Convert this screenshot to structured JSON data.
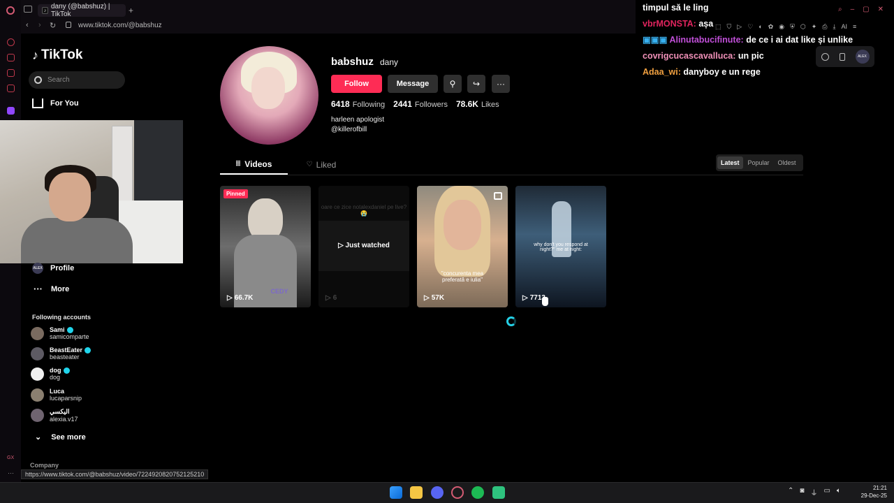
{
  "browser": {
    "tab_title": "dany (@babshuz) | TikTok",
    "new_tab": "+",
    "url": "www.tiktok.com/@babshuz",
    "status_url": "https://www.tiktok.com/@babshuz/video/7224920820752125210"
  },
  "tiktok": {
    "logo": "TikTok",
    "search_placeholder": "Search",
    "nav": {
      "for_you": "For You",
      "profile": "Profile",
      "more": "More",
      "profile_avatar": "ALEX"
    },
    "following_header": "Following accounts",
    "following": [
      {
        "name": "Sami",
        "user": "samicomparte",
        "verified": true
      },
      {
        "name": "BeastEater",
        "user": "beasteater",
        "verified": true
      },
      {
        "name": "dog",
        "user": "dog",
        "verified": true
      },
      {
        "name": "Luca",
        "user": "lucaparsnip",
        "verified": false
      },
      {
        "name": "اليكسي",
        "user": "alexia.v17",
        "verified": false
      }
    ],
    "see_more": "See more",
    "company": "Company"
  },
  "profile": {
    "username": "babshuz",
    "nickname": "dany",
    "follow_label": "Follow",
    "message_label": "Message",
    "following_count": "6418",
    "following_label": "Following",
    "followers_count": "2441",
    "followers_label": "Followers",
    "likes_count": "78.6K",
    "likes_label": "Likes",
    "bio_line1": "harleen apologist",
    "bio_line2": "@killerofbill"
  },
  "tabs": {
    "videos": "Videos",
    "liked": "Liked"
  },
  "sort": [
    "Latest",
    "Popular",
    "Oldest"
  ],
  "sort_active": "Latest",
  "videos": [
    {
      "views": "66.7K",
      "badge": "Pinned",
      "caption": "CEDY"
    },
    {
      "views": "6",
      "overlay": "Just watched",
      "ghost": "oare ce zice notalexdaniel pe live?😭"
    },
    {
      "views": "57K",
      "caption": "\"concurenta mea preferată e iulia\""
    },
    {
      "views": "7713",
      "caption": "why don't you respond at night?\" me at night:"
    }
  ],
  "chat": [
    {
      "user": "",
      "text": "timpul să le ling",
      "color": "#ffffff"
    },
    {
      "user": "vbrMONSTA:",
      "text": "așa",
      "color": "#e0245e"
    },
    {
      "user": "Alinutabucifinute:",
      "text": "de ce i ai dat like și unlike",
      "color": "#c04fd8"
    },
    {
      "user": "covrigcucascavalluca:",
      "text": "un pic",
      "color": "#f090b8"
    },
    {
      "user": "Adaa_wi:",
      "text": "danyboy e un rege",
      "color": "#f0a040"
    }
  ],
  "extension": {
    "avatar": "ALEX"
  },
  "taskbar": {
    "time": "21:21",
    "date": "29-Dec-25"
  },
  "colors": {
    "accent": "#fe2c55",
    "verified": "#20d5ec",
    "loader": "#25d0e6"
  }
}
